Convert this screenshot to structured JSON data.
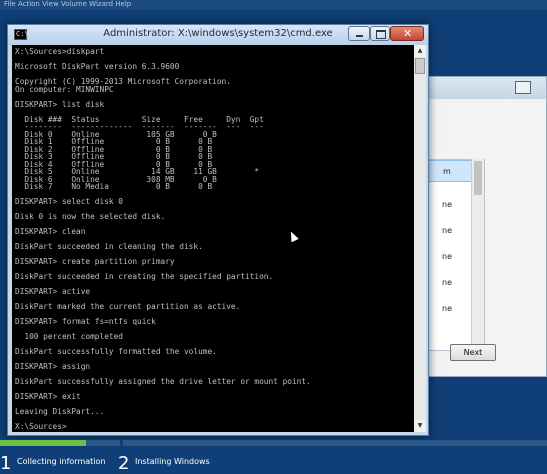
{
  "desktop": {
    "top_strip": "File  Action  View  Volume  Wizard  Help"
  },
  "cmd": {
    "title": "Administrator: X:\\windows\\system32\\cmd.exe",
    "icon_label": "C:\\",
    "lines": [
      "X:\\Sources>diskpart",
      "",
      "Microsoft DiskPart version 6.3.9600",
      "",
      "Copyright (C) 1999-2013 Microsoft Corporation.",
      "On computer: MINWINPC",
      "",
      "DISKPART> list disk",
      "",
      "  Disk ###  Status         Size     Free     Dyn  Gpt",
      "  --------  -------------  -------  -------  ---  ---",
      "  Disk 0    Online          105 GB      0 B",
      "  Disk 1    Offline           0 B      0 B",
      "  Disk 2    Offline           0 B      0 B",
      "  Disk 3    Offline           0 B      0 B",
      "  Disk 4    Offline           0 B      0 B",
      "  Disk 5    Online           14 GB    11 GB        *",
      "  Disk 6    Online          308 MB      0 B",
      "  Disk 7    No Media          0 B      0 B",
      "",
      "DISKPART> select disk 0",
      "",
      "Disk 0 is now the selected disk.",
      "",
      "DISKPART> clean",
      "",
      "DiskPart succeeded in cleaning the disk.",
      "",
      "DISKPART> create partition primary",
      "",
      "DiskPart succeeded in creating the specified partition.",
      "",
      "DISKPART> active",
      "",
      "DiskPart marked the current partition as active.",
      "",
      "DISKPART> format fs=ntfs quick",
      "",
      "  100 percent completed",
      "",
      "DiskPart successfully formatted the volume.",
      "",
      "DISKPART> assign",
      "",
      "DiskPart successfully assigned the drive letter or mount point.",
      "",
      "DISKPART> exit",
      "",
      "Leaving DiskPart...",
      "",
      "X:\\Sources>"
    ]
  },
  "wizard": {
    "list_items": [
      "m",
      "ne",
      "ne",
      "ne",
      "ne",
      "ne"
    ],
    "next_label": "Next"
  },
  "progress": {
    "completed_steps": 1,
    "steps": [
      {
        "number": "1",
        "label": "Collecting information"
      },
      {
        "number": "2",
        "label": "Installing Windows"
      }
    ]
  },
  "colors": {
    "background": "#0f3f76",
    "console_bg": "#000000",
    "console_text": "#c0c0c0",
    "progress_done": "#6cc04a",
    "close_button": "#c3452d"
  }
}
